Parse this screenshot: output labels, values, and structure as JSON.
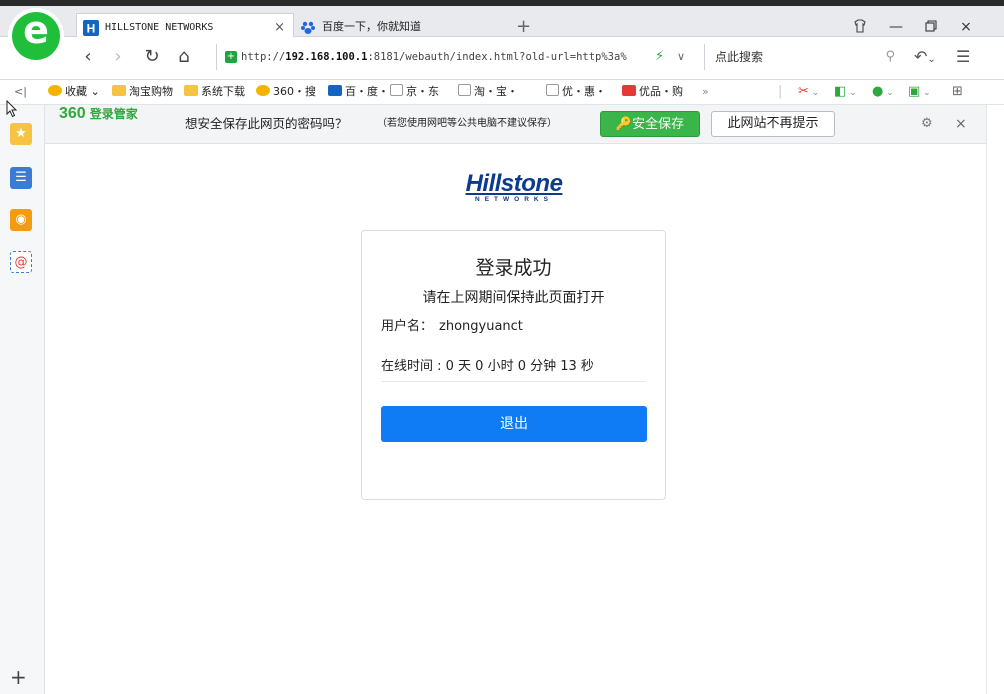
{
  "tabs": [
    {
      "title": "HILLSTONE NETWORKS",
      "close": "×",
      "favicon": "hillstone-favicon"
    },
    {
      "title": "百度一下，你就知道",
      "favicon": "baidu-favicon"
    }
  ],
  "new_tab": "+",
  "window_controls": {
    "skin": "♡",
    "minimize": "—",
    "maximize": "▫",
    "close": "×"
  },
  "nav": {
    "back": "‹",
    "forward": "›",
    "refresh": "↻",
    "home": "⌂",
    "url_prefix": "http://",
    "url_host": "192.168.100.1",
    "url_rest": ":8181/webauth/index.html?old-url=http%3a%",
    "search_placeholder": "点此搜索"
  },
  "bookmarks": [
    {
      "label": "收藏",
      "color": "#f2b400"
    },
    {
      "label": "淘宝购物",
      "color": "#f6c343"
    },
    {
      "label": "系统下载",
      "color": "#f6c343"
    },
    {
      "label": "360・搜",
      "color": "#f2b400"
    },
    {
      "label": "百・度・",
      "color": "#1565c0"
    },
    {
      "label": "京・东",
      "color": "#dddddd"
    },
    {
      "label": "淘・宝・",
      "color": "#dddddd"
    },
    {
      "label": "优・惠・",
      "color": "#dddddd"
    },
    {
      "label": "优品・购",
      "color": "#e53935"
    }
  ],
  "bookmark_more": "»",
  "password_bar": {
    "brand": "360",
    "brand_sub": "登录管家",
    "question": "想安全保存此网页的密码吗？",
    "note": "（若您使用网吧等公共电脑不建议保存）",
    "save_label": "安全保存",
    "never_label": "此网站不再提示"
  },
  "content": {
    "brand_name": "Hillstone",
    "brand_sub": "NETWORKS",
    "title": "登录成功",
    "subtitle": "请在上网期间保持此页面打开",
    "username_label": "用户名：",
    "username": "zhongyuanct",
    "online_time": "在线时间 : 0 天 0 小时 0 分钟 13 秒",
    "logout_label": "退出"
  },
  "colors": {
    "accent_green": "#3ab54a",
    "logout_blue": "#0f7cf6",
    "brand_navy": "#0c3a8c"
  }
}
